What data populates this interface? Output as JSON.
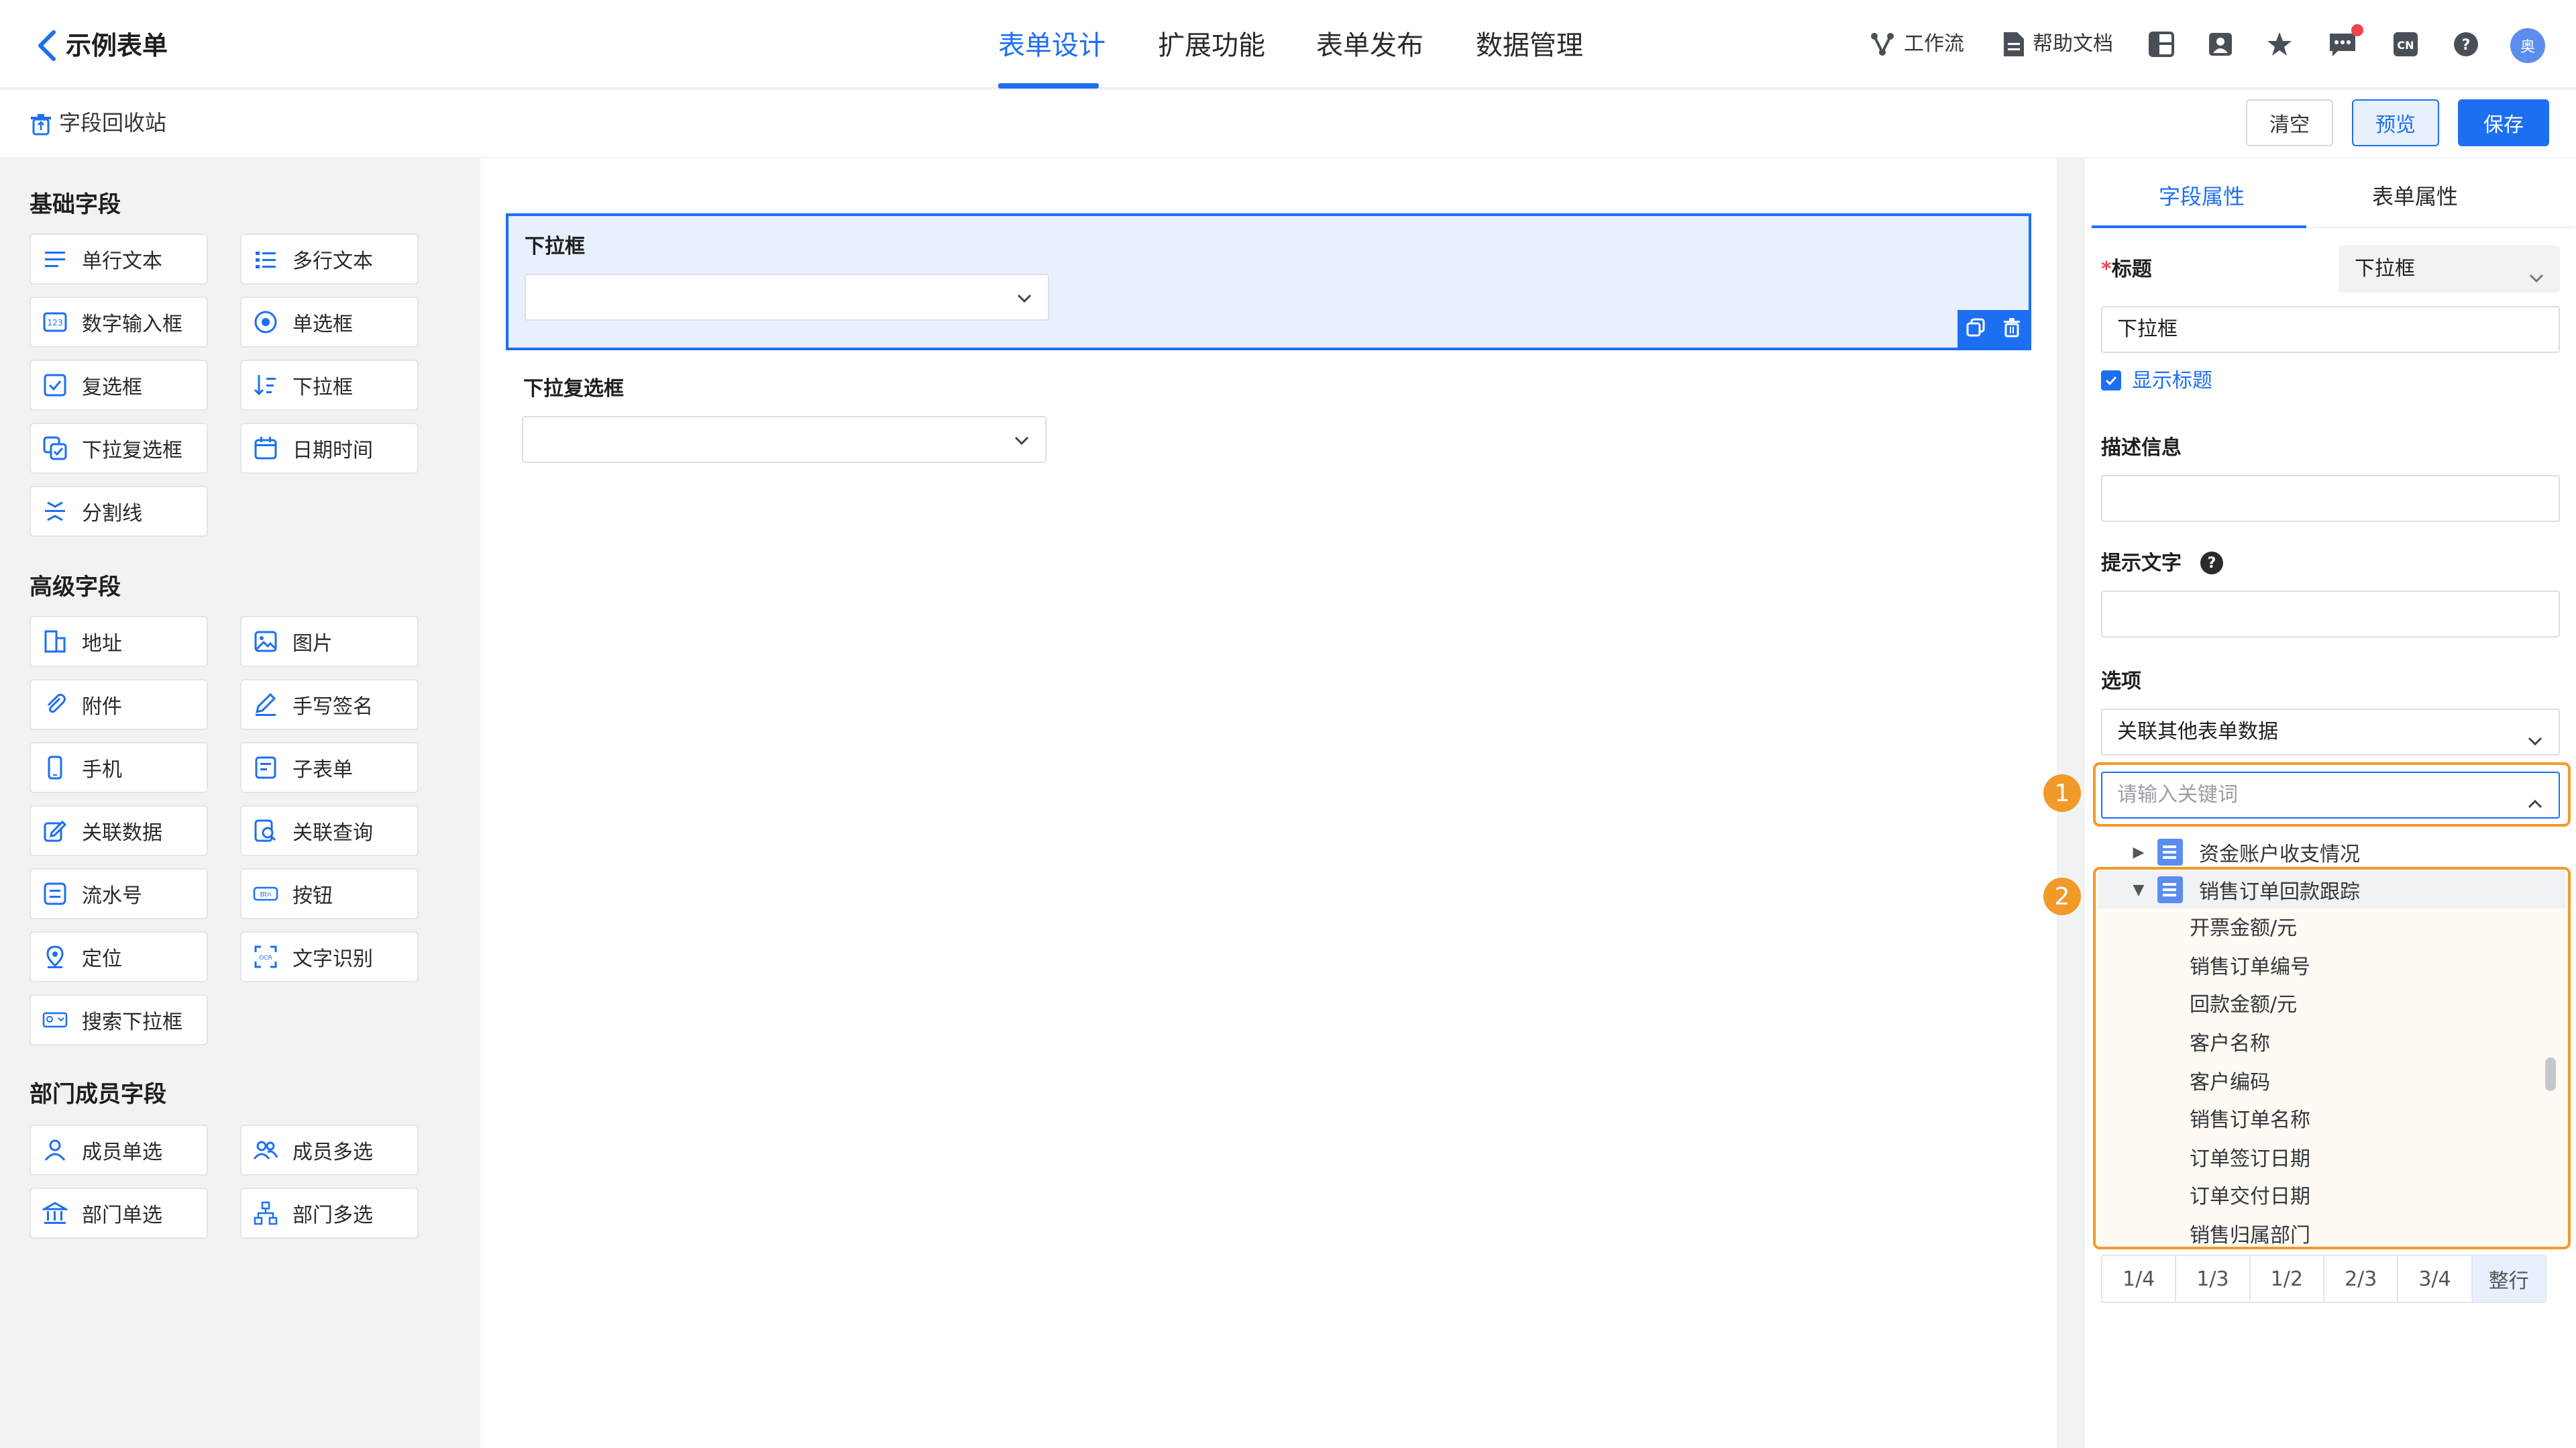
{
  "header": {
    "app_title": "示例表单",
    "tabs": [
      {
        "label": "表单设计"
      },
      {
        "label": "扩展功能"
      },
      {
        "label": "表单发布"
      },
      {
        "label": "数据管理"
      }
    ],
    "workflow": "工作流",
    "help_docs": "帮助文档",
    "avatar_text": "奥"
  },
  "subbar": {
    "recycle_bin": "字段回收站",
    "clear": "清空",
    "preview": "预览",
    "save": "保存"
  },
  "left_panel": {
    "sections": [
      {
        "title": "基础字段",
        "items": [
          "单行文本",
          "多行文本",
          "数字输入框",
          "单选框",
          "复选框",
          "下拉框",
          "下拉复选框",
          "日期时间",
          "分割线"
        ]
      },
      {
        "title": "高级字段",
        "items": [
          "地址",
          "图片",
          "附件",
          "手写签名",
          "手机",
          "子表单",
          "关联数据",
          "关联查询",
          "流水号",
          "按钮",
          "定位",
          "文字识别",
          "搜索下拉框"
        ]
      },
      {
        "title": "部门成员字段",
        "items": [
          "成员单选",
          "成员多选",
          "部门单选",
          "部门多选"
        ]
      }
    ]
  },
  "canvas": {
    "fields": [
      {
        "label": "下拉框"
      },
      {
        "label": "下拉复选框"
      }
    ]
  },
  "right_panel": {
    "tabs": [
      "字段属性",
      "表单属性"
    ],
    "title_label": "标题",
    "title_required_mark": "*",
    "title_type": "下拉框",
    "title_value": "下拉框",
    "show_title": "显示标题",
    "description_label": "描述信息",
    "hint_label": "提示文字",
    "options_label": "选项",
    "options_source": "关联其他表单数据",
    "keyword_placeholder": "请输入关键词",
    "badges": [
      "1",
      "2"
    ],
    "tree": {
      "collapsed": "资金账户收支情况",
      "expanded": "销售订单回款跟踪",
      "children": [
        "开票金额/元",
        "销售订单编号",
        "回款金额/元",
        "客户名称",
        "客户编码",
        "销售订单名称",
        "订单签订日期",
        "订单交付日期",
        "销售归属部门"
      ]
    },
    "width_options": [
      "1/4",
      "1/3",
      "1/2",
      "2/3",
      "3/4",
      "整行"
    ]
  },
  "colors": {
    "primary": "#1d6ff2",
    "highlight": "#f19a2a",
    "selected_bg": "#e8f0fe"
  },
  "icons": {
    "back": "chevron-left-icon",
    "workflow": "workflow-icon",
    "help_docs": "document-icon",
    "recycle": "recycle-bin-icon"
  }
}
